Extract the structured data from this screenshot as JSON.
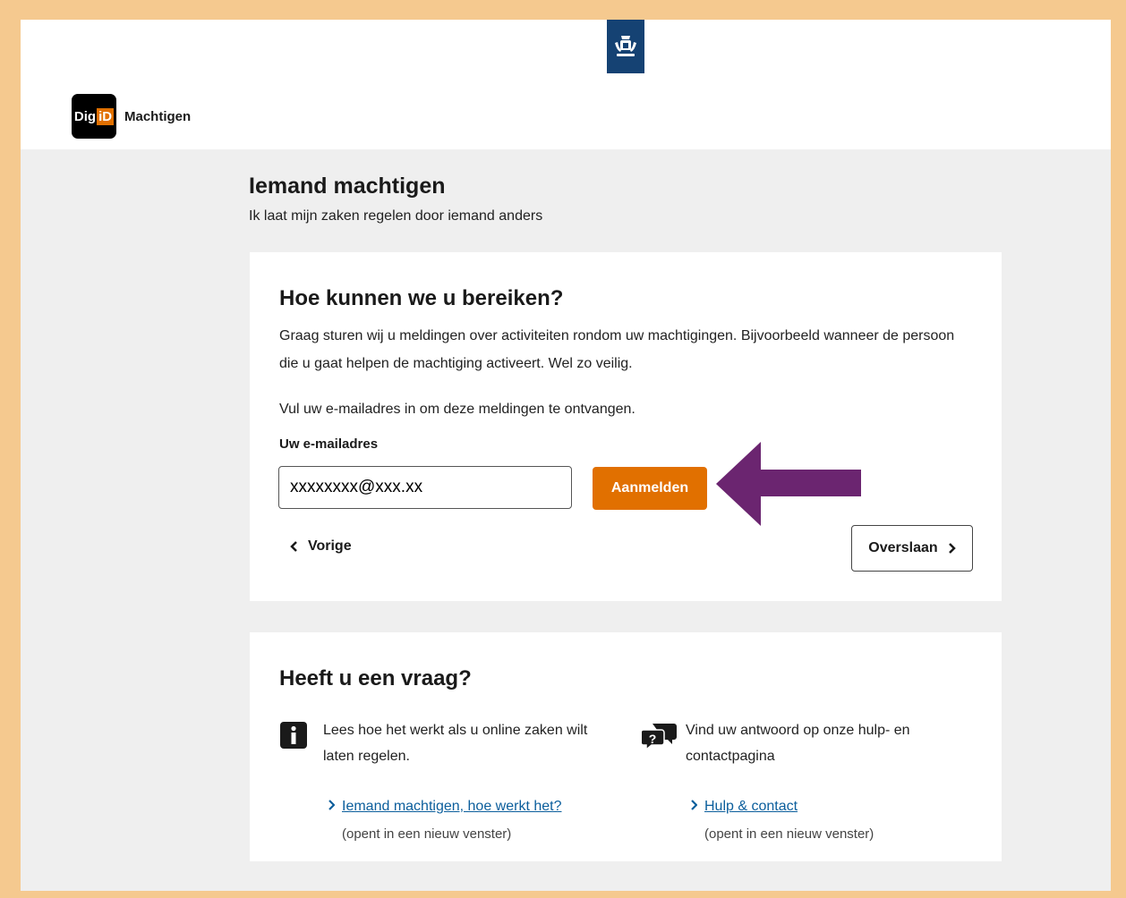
{
  "header": {
    "brand_logo_text_a": "Dig",
    "brand_logo_text_b": "iD",
    "brand_name": "Machtigen"
  },
  "page": {
    "title": "Iemand machtigen",
    "subtitle": "Ik laat mijn zaken regelen door iemand anders"
  },
  "contact_card": {
    "heading": "Hoe kunnen we u bereiken?",
    "paragraph1": "Graag sturen wij u meldingen over activiteiten rondom uw machtigingen. Bijvoorbeeld wanneer de persoon die u gaat helpen de machtiging activeert. Wel zo veilig.",
    "paragraph2": "Vul uw e-mailadres in om deze meldingen te ontvangen.",
    "email_label": "Uw e-mailadres",
    "email_value": "xxxxxxxx@xxx.xx",
    "submit_label": "Aanmelden",
    "back_label": "Vorige",
    "skip_label": "Overslaan"
  },
  "help_card": {
    "heading": "Heeft u een vraag?",
    "left": {
      "text": "Lees hoe het werkt als u online zaken wilt laten regelen.",
      "link": "Iemand machtigen, hoe werkt het?",
      "note": "(opent in een nieuw venster)"
    },
    "right": {
      "text": "Vind uw antwoord op onze hulp- en contactpagina",
      "link": "Hulp & contact",
      "note": "(opent in een nieuw venster)"
    }
  },
  "colors": {
    "accent": "#e17000",
    "rijks_blue": "#154273",
    "arrow": "#6b2570",
    "link": "#0b5e9c",
    "frame": "#f5c98f"
  },
  "icons": {
    "gov_logo": "rijksoverheid-crest-icon",
    "annotation": "arrow-left-icon",
    "info": "info-icon",
    "chat": "chat-question-icon"
  }
}
